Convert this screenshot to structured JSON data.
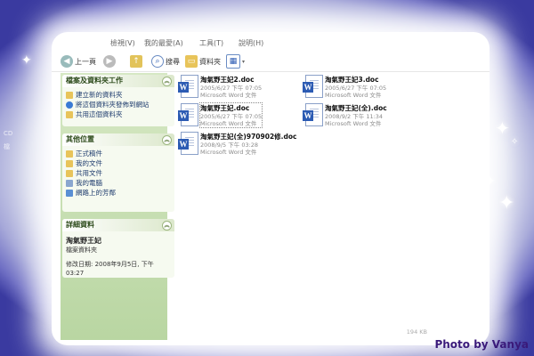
{
  "menu": {
    "items": [
      "檢視(V)",
      "我的最愛(A)",
      "工具(T)",
      "說明(H)"
    ]
  },
  "toolbar": {
    "back_label": "上一頁",
    "search_label": "搜尋",
    "folders_label": "資料夾"
  },
  "task_panels": {
    "file_tasks": {
      "title": "檔案及資料夾工作",
      "links": [
        "建立新的資料夾",
        "將這個資料夾發佈到網站",
        "共用這個資料夾"
      ]
    },
    "other_places": {
      "title": "其他位置",
      "links": [
        "正式稿件",
        "我的文件",
        "共用文件",
        "我的電腦",
        "網路上的芳鄰"
      ]
    },
    "details": {
      "title": "詳細資料",
      "name": "淘氣野王妃",
      "type": "檔案資料夾",
      "modified": "修改日期: 2008年9月5日, 下午 03:27"
    }
  },
  "files": [
    {
      "name": "淘氣野王妃2.doc",
      "date": "2005/6/27 下午 07:05",
      "type": "Microsoft Word 文件",
      "selected": false
    },
    {
      "name": "淘氣野王妃3.doc",
      "date": "2005/6/27 下午 07:05",
      "type": "Microsoft Word 文件",
      "selected": false
    },
    {
      "name": "淘氣野王妃.doc",
      "date": "2005/6/27 下午 07:05",
      "type": "Microsoft Word 文件",
      "selected": true
    },
    {
      "name": "淘氣野王妃(全).doc",
      "date": "2008/9/2 下午 11:34",
      "type": "Microsoft Word 文件",
      "selected": false
    },
    {
      "name": "淘氣野王妃(全)970902修.doc",
      "date": "2008/9/5 下午 03:28",
      "type": "Microsoft Word 文件",
      "selected": false
    }
  ],
  "status": {
    "size": "194 KB"
  },
  "left_ghost": {
    "lines": [
      "CD",
      "檔"
    ]
  },
  "credit": "Photo by Vanya",
  "colors": {
    "accent": "#3a1a7a",
    "word_blue": "#2c5bb3",
    "pane_green": "#b9d6a2"
  }
}
